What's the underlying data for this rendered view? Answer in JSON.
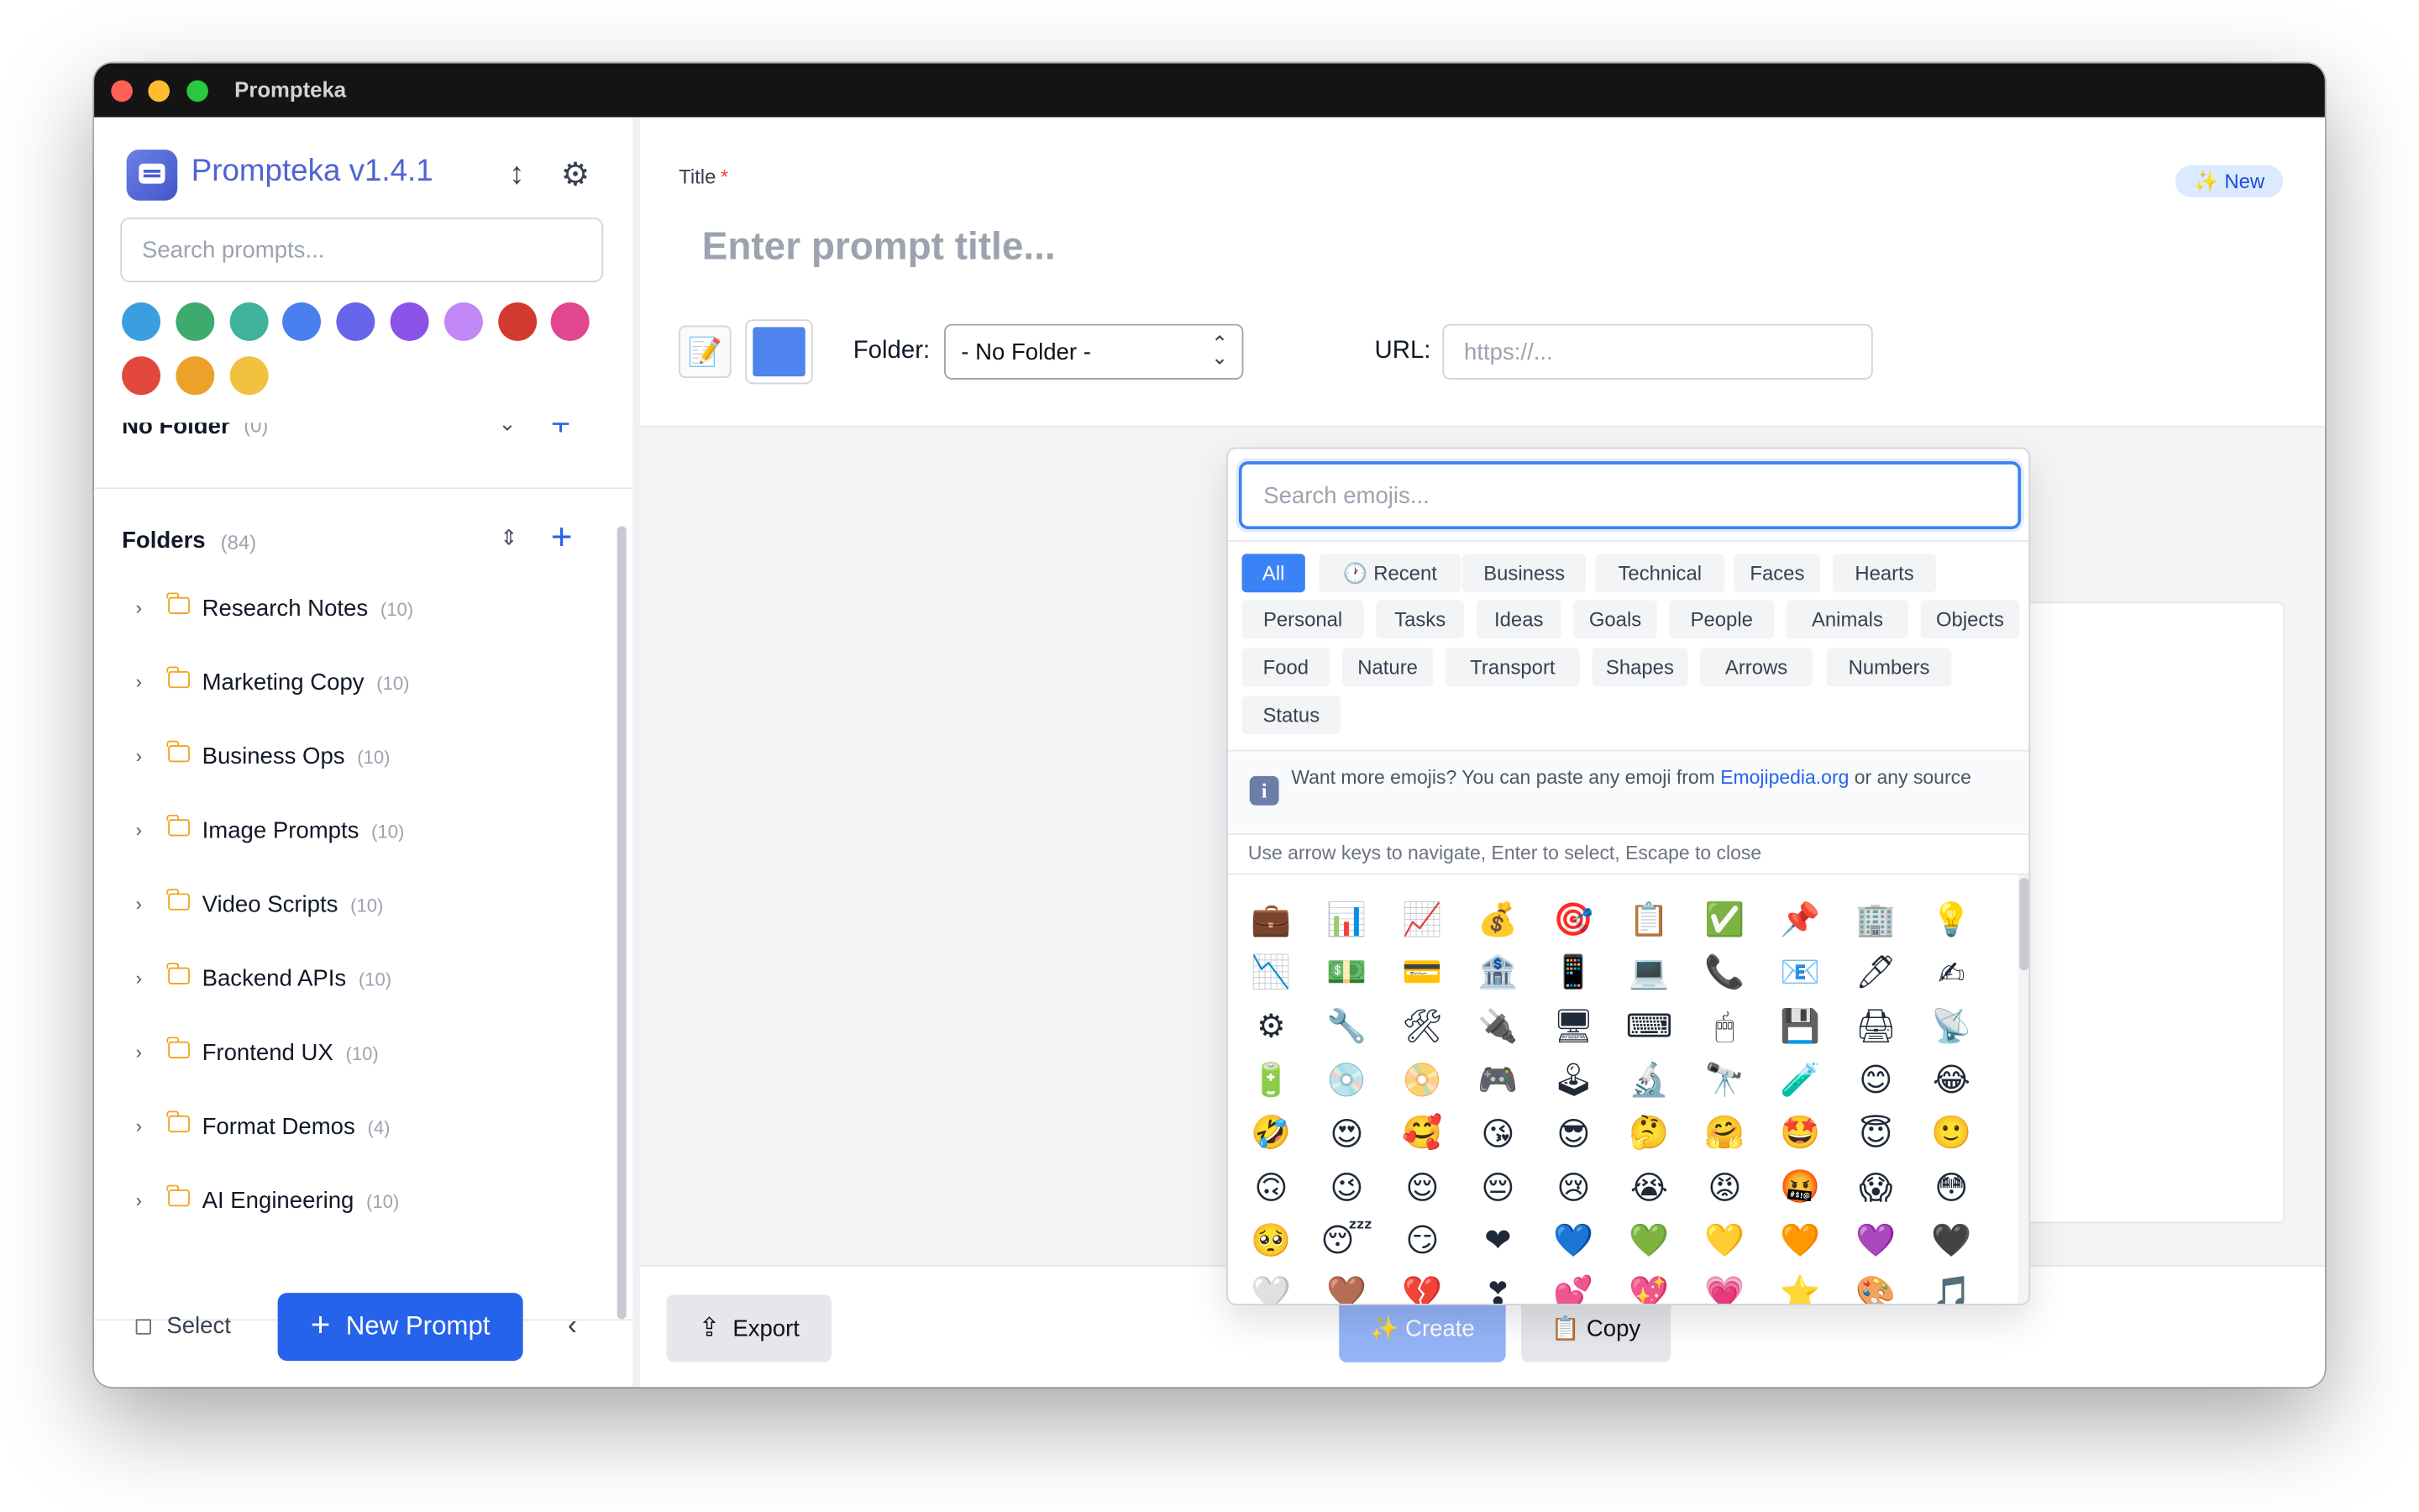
{
  "window": {
    "title": "Prompteka"
  },
  "sidebar": {
    "app_name": "Prompteka v1.4.1",
    "search_placeholder": "Search prompts...",
    "color_swatches": [
      "#3b9ee0",
      "#3daa6e",
      "#3fb39b",
      "#4a7ff0",
      "#6664e8",
      "#8b52e8",
      "#c188f5",
      "#d33a2f",
      "#e0478f",
      "#e2473c",
      "#eba12a",
      "#f2c140"
    ],
    "no_folder": {
      "label": "No Folder",
      "count": "(0)"
    },
    "folders": {
      "label": "Folders",
      "count": "(84)",
      "items": [
        {
          "name": "Research Notes",
          "count": "(10)"
        },
        {
          "name": "Marketing Copy",
          "count": "(10)"
        },
        {
          "name": "Business Ops",
          "count": "(10)"
        },
        {
          "name": "Image Prompts",
          "count": "(10)"
        },
        {
          "name": "Video Scripts",
          "count": "(10)"
        },
        {
          "name": "Backend APIs",
          "count": "(10)"
        },
        {
          "name": "Frontend UX",
          "count": "(10)"
        },
        {
          "name": "Format Demos",
          "count": "(4)"
        },
        {
          "name": "AI Engineering",
          "count": "(10)"
        }
      ]
    },
    "select_label": "Select",
    "new_prompt_label": "New Prompt"
  },
  "editor": {
    "title_label": "Title",
    "required_mark": "*",
    "new_badge": "✨ New",
    "title_placeholder": "Enter prompt title...",
    "emoji_button": "📝",
    "selected_color": "#4f83ee",
    "folder_label": "Folder:",
    "folder_value": "- No Folder -",
    "url_label": "URL:",
    "url_placeholder": "https://...",
    "content_placeholder_tail": ".)..."
  },
  "footer": {
    "export_label": "Export",
    "create_label": "✨ Create",
    "copy_label": "📋 Copy"
  },
  "emoji_picker": {
    "search_placeholder": "Search emojis...",
    "categories": [
      "All",
      "🕐 Recent",
      "Business",
      "Technical",
      "Faces",
      "Hearts",
      "Personal",
      "Tasks",
      "Ideas",
      "Goals",
      "People",
      "Animals",
      "Objects",
      "Food",
      "Nature",
      "Transport",
      "Shapes",
      "Arrows",
      "Numbers",
      "Status"
    ],
    "active_category": "All",
    "info_prefix": "Want more emojis? You can paste any emoji from ",
    "info_link": "Emojipedia.org",
    "info_suffix": " or any source",
    "hint": "Use arrow keys to navigate, Enter to select, Escape to close",
    "emojis": [
      "💼",
      "📊",
      "📈",
      "💰",
      "🎯",
      "📋",
      "✅",
      "📌",
      "🏢",
      "💡",
      "📉",
      "💵",
      "💳",
      "🏦",
      "📱",
      "💻",
      "📞",
      "📧",
      "🖊",
      "✍",
      "⚙",
      "🔧",
      "🛠",
      "🔌",
      "🖥",
      "⌨",
      "🖱",
      "💾",
      "🖨",
      "📡",
      "🔋",
      "💿",
      "📀",
      "🎮",
      "🕹",
      "🔬",
      "🔭",
      "🧪",
      "😊",
      "😂",
      "🤣",
      "😍",
      "🥰",
      "😘",
      "😎",
      "🤔",
      "🤗",
      "🤩",
      "😇",
      "🙂",
      "🙃",
      "😉",
      "😌",
      "😔",
      "😢",
      "😭",
      "😡",
      "🤬",
      "😱",
      "😳",
      "🥺",
      "😴",
      "😏",
      "❤",
      "💙",
      "💚",
      "💛",
      "🧡",
      "💜",
      "🖤",
      "🤍",
      "🤎",
      "💔",
      "❣",
      "💕",
      "💖",
      "💗",
      "⭐",
      "🎨",
      "🎵"
    ]
  }
}
